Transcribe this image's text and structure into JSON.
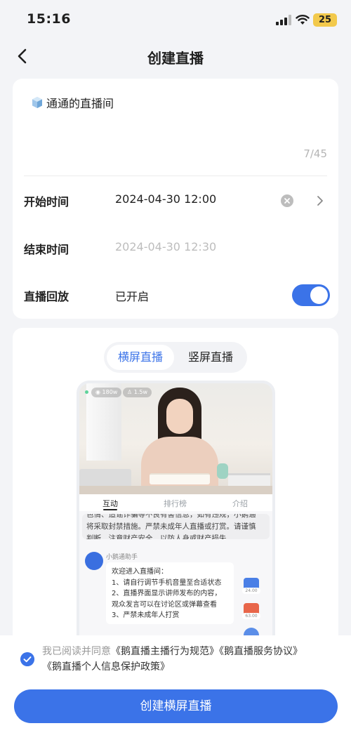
{
  "status_bar": {
    "time": "15:16",
    "battery": "25"
  },
  "nav": {
    "title": "创建直播"
  },
  "form": {
    "title_value": "通通的直播间",
    "char_count": "7/45",
    "start_time": {
      "label": "开始时间",
      "value": "2024-04-30 12:00"
    },
    "end_time": {
      "label": "结束时间",
      "value": "2024-04-30 12:30"
    },
    "replay": {
      "label": "直播回放",
      "value": "已开启",
      "enabled": true
    }
  },
  "mode_tabs": {
    "landscape": "横屏直播",
    "portrait": "竖屏直播",
    "selected": "landscape"
  },
  "preview": {
    "viewers": "180w",
    "likes": "1.5w",
    "tabs": [
      "互动",
      "排行榜",
      "介绍"
    ],
    "notice_line1": "色情、造谣诈骗等不良有害信息，如有违规，小鹅通",
    "notice_line2": "将采取封禁措施。严禁未成年人直播或打赏。请谨慎",
    "notice_line3": "判断，注意财产安全，以防人身或财产损失。",
    "bot_name": "小鹅通助手",
    "bot_lines": [
      "欢迎进入直播间：",
      "1、请自行调节手机音量至合适状态",
      "2、直播界面显示讲师发布的内容，",
      "观众发言可以在讨论区或弹幕查看",
      "3、严禁未成年人打赏"
    ],
    "side_prices": [
      "24.00",
      "63.00"
    ]
  },
  "agreement": {
    "prefix": "我已阅读并同意",
    "link1": "《鹅直播主播行为规范》",
    "link2": "《鹅直播服务协议》",
    "link3": "《鹅直播个人信息保护政策》"
  },
  "create_button": "创建横屏直播",
  "colors": {
    "accent": "#3b73e8",
    "background": "#f3f4f7"
  }
}
